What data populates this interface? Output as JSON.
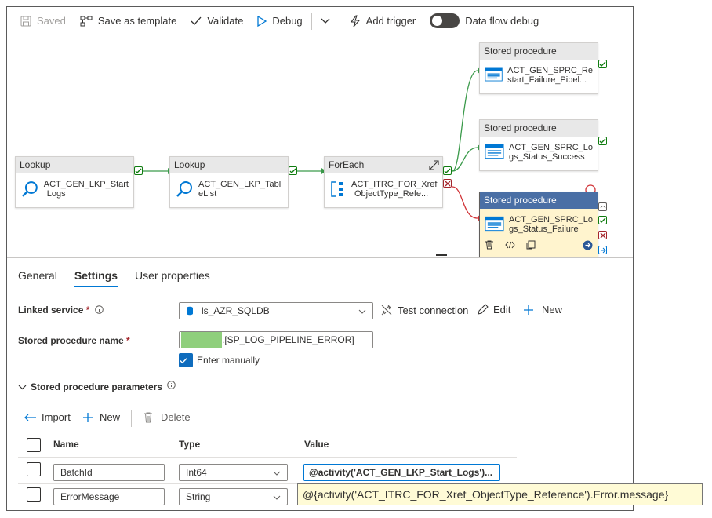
{
  "toolbar": {
    "saved": "Saved",
    "save_template": "Save as template",
    "validate": "Validate",
    "debug": "Debug",
    "add_trigger": "Add trigger",
    "data_flow_debug": "Data flow debug"
  },
  "canvas": {
    "nodes": [
      {
        "type": "Lookup",
        "name_line1": "ACT_GEN_LKP_Start",
        "name_line2": "Logs"
      },
      {
        "type": "Lookup",
        "name_line1": "ACT_GEN_LKP_Tabl",
        "name_line2": "eList"
      },
      {
        "type": "ForEach",
        "name_line1": "ACT_ITRC_FOR_Xref",
        "name_line2": "ObjectType_Refe..."
      },
      {
        "type": "Stored procedure",
        "name_line1": "ACT_GEN_SPRC_Re",
        "name_line2": "start_Failure_Pipel..."
      },
      {
        "type": "Stored procedure",
        "name_line1": "ACT_GEN_SPRC_Lo",
        "name_line2": "gs_Status_Success"
      },
      {
        "type": "Stored procedure",
        "name_line1": "ACT_GEN_SPRC_Lo",
        "name_line2": "gs_Status_Failure"
      }
    ]
  },
  "tabs": [
    "General",
    "Settings",
    "User properties"
  ],
  "settings": {
    "linked_service_label": "Linked service",
    "linked_service_value": "ls_AZR_SQLDB",
    "test_connection": "Test connection",
    "edit": "Edit",
    "new": "New",
    "sp_name_label": "Stored procedure name",
    "sp_name_value": ".[SP_LOG_PIPELINE_ERROR]",
    "enter_manually": "Enter manually",
    "params_label": "Stored procedure parameters",
    "import": "Import",
    "params_new": "New",
    "delete": "Delete"
  },
  "params_table": {
    "headers": [
      "Name",
      "Type",
      "Value"
    ],
    "rows": [
      {
        "name": "BatchId",
        "type": "Int64",
        "value": "@activity('ACT_GEN_LKP_Start_Logs')..."
      },
      {
        "name": "ErrorMessage",
        "type": "String",
        "value": ""
      }
    ]
  },
  "tooltip": "@{activity('ACT_ITRC_FOR_Xref_ObjectType_Reference').Error.message}",
  "colors": {
    "accent": "#0078d4",
    "success": "#107c10",
    "failure": "#a4262c",
    "selected_bg": "#fff4ce",
    "redacted": "#8fcf7c"
  }
}
